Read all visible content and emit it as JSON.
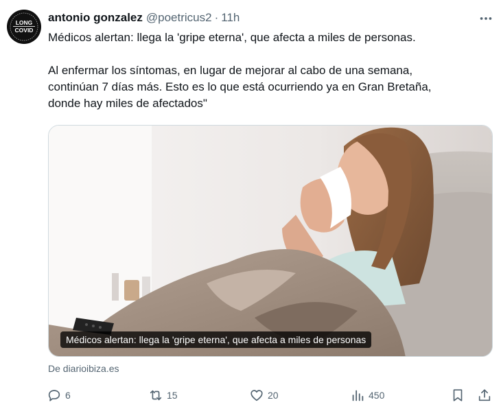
{
  "tweet": {
    "avatar_text": [
      "LONG",
      "COVID"
    ],
    "display_name": "antonio gonzalez",
    "handle": "@poetricus2",
    "separator": "·",
    "time": "11h",
    "text": [
      "Médicos alertan: llega la 'gripe eterna', que afecta a miles de personas.",
      "Al enfermar los síntomas, en lugar de mejorar al cabo de una semana,",
      "continúan 7 días más. Esto es lo que está ocurriendo ya en Gran Bretaña,",
      "donde hay miles de afectados\""
    ],
    "media_caption": "Médicos alertan: llega la 'gripe eterna', que afecta a miles de personas",
    "source": "De diarioibiza.es"
  },
  "actions": {
    "replies": "6",
    "retweets": "15",
    "likes": "20",
    "views": "450"
  },
  "icons": {
    "more": "more-horizontal-icon",
    "reply": "reply-bubble-icon",
    "retweet": "retweet-icon",
    "like": "heart-icon",
    "views": "bar-chart-icon",
    "bookmark": "bookmark-icon",
    "share": "share-upload-icon"
  },
  "colors": {
    "text": "#0f1419",
    "secondary": "#536471",
    "border": "#cfd9de"
  }
}
